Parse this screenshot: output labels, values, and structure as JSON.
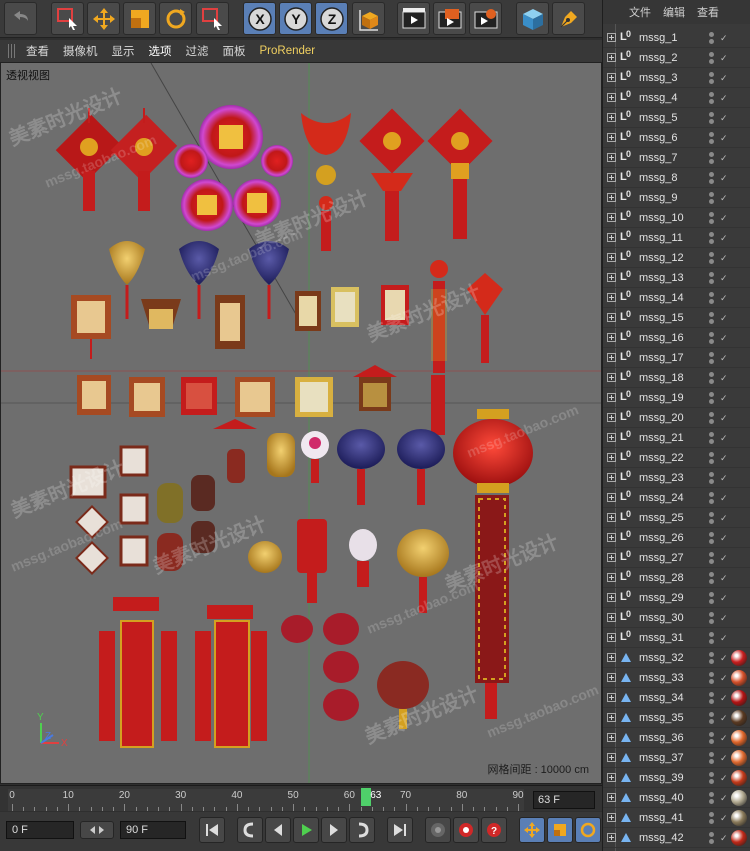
{
  "toolbar": {
    "buttons": [
      "undo",
      "live-select",
      "move",
      "scale",
      "rotate",
      "recent-tool",
      "lock-x",
      "lock-y",
      "lock-z",
      "coordinate-system",
      "render-view",
      "render-picture-viewer",
      "edit-render-settings",
      "cube",
      "pen"
    ],
    "axis_labels": [
      "X",
      "Y",
      "Z"
    ]
  },
  "viewport_menu": {
    "items": [
      "查看",
      "摄像机",
      "显示",
      "选项",
      "过滤",
      "面板",
      "ProRender"
    ]
  },
  "viewport": {
    "label": "透视视图",
    "grid_spacing": "网格间距 : 10000 cm",
    "watermark_cn": "美素时光设计",
    "watermark_url": "mssg.taobao.com",
    "axis": {
      "x": "X",
      "y": "Y",
      "z": "Z"
    }
  },
  "timeline": {
    "ticks": [
      "0",
      "10",
      "20",
      "30",
      "40",
      "50",
      "60",
      "70",
      "80",
      "90"
    ],
    "current_frame": "63",
    "current_frame_field": "63 F"
  },
  "transport": {
    "start_field": "0 F",
    "end_field": "90 F"
  },
  "object_manager": {
    "menu": [
      "文件",
      "编辑",
      "查看"
    ],
    "objects": [
      {
        "name": "mssg_1",
        "type": "null"
      },
      {
        "name": "mssg_2",
        "type": "null"
      },
      {
        "name": "mssg_3",
        "type": "null"
      },
      {
        "name": "mssg_4",
        "type": "null"
      },
      {
        "name": "mssg_5",
        "type": "null"
      },
      {
        "name": "mssg_6",
        "type": "null"
      },
      {
        "name": "mssg_7",
        "type": "null"
      },
      {
        "name": "mssg_8",
        "type": "null"
      },
      {
        "name": "mssg_9",
        "type": "null"
      },
      {
        "name": "mssg_10",
        "type": "null"
      },
      {
        "name": "mssg_11",
        "type": "null"
      },
      {
        "name": "mssg_12",
        "type": "null"
      },
      {
        "name": "mssg_13",
        "type": "null"
      },
      {
        "name": "mssg_14",
        "type": "null"
      },
      {
        "name": "mssg_15",
        "type": "null"
      },
      {
        "name": "mssg_16",
        "type": "null"
      },
      {
        "name": "mssg_17",
        "type": "null"
      },
      {
        "name": "mssg_18",
        "type": "null"
      },
      {
        "name": "mssg_19",
        "type": "null"
      },
      {
        "name": "mssg_20",
        "type": "null"
      },
      {
        "name": "mssg_21",
        "type": "null"
      },
      {
        "name": "mssg_22",
        "type": "null"
      },
      {
        "name": "mssg_23",
        "type": "null"
      },
      {
        "name": "mssg_24",
        "type": "null"
      },
      {
        "name": "mssg_25",
        "type": "null"
      },
      {
        "name": "mssg_26",
        "type": "null"
      },
      {
        "name": "mssg_27",
        "type": "null"
      },
      {
        "name": "mssg_28",
        "type": "null"
      },
      {
        "name": "mssg_29",
        "type": "null"
      },
      {
        "name": "mssg_30",
        "type": "null"
      },
      {
        "name": "mssg_31",
        "type": "null"
      },
      {
        "name": "mssg_32",
        "type": "poly",
        "material": "#c81e1e"
      },
      {
        "name": "mssg_33",
        "type": "poly",
        "material": "#d4502a"
      },
      {
        "name": "mssg_34",
        "type": "poly",
        "material": "#b41414"
      },
      {
        "name": "mssg_35",
        "type": "poly",
        "material": "#5a3a22"
      },
      {
        "name": "mssg_36",
        "type": "poly",
        "material": "#e0662a"
      },
      {
        "name": "mssg_37",
        "type": "poly",
        "material": "#e06a30"
      },
      {
        "name": "mssg_39",
        "type": "poly",
        "material": "#c43a1a"
      },
      {
        "name": "mssg_40",
        "type": "poly",
        "material": "#b0a890"
      },
      {
        "name": "mssg_41",
        "type": "poly",
        "material": "#8a7a5a"
      },
      {
        "name": "mssg_42",
        "type": "poly",
        "material": "#c02818"
      }
    ]
  }
}
